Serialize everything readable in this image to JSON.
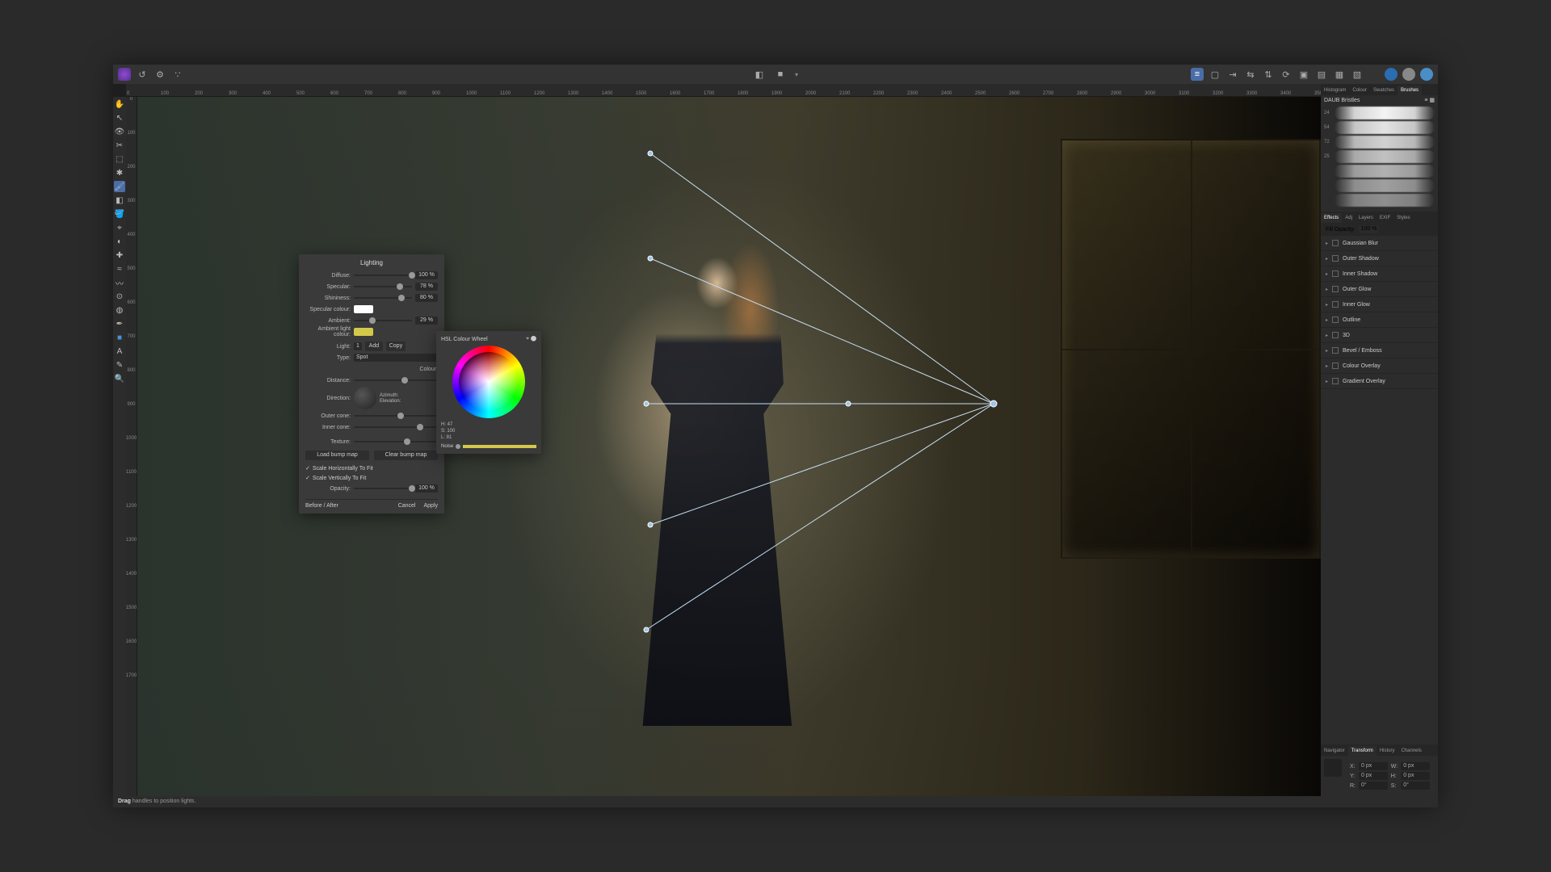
{
  "ruler": {
    "start": 0,
    "step": 100,
    "count": 40,
    "vcount": 18
  },
  "topbar": {
    "center_icons": [
      "◧",
      "■"
    ],
    "right_round": [
      "●",
      "●",
      "●"
    ]
  },
  "tabs_top_right": {
    "items": [
      "Histogram",
      "Colour",
      "Swatches",
      "Brushes"
    ],
    "active": 3
  },
  "brushes": {
    "category": "DAUB Bristles",
    "sizes": [
      "24",
      "54",
      "72",
      "25"
    ]
  },
  "tabs_fx": {
    "items": [
      "Effects",
      "Adj",
      "Layers",
      "EXIF",
      "Styles"
    ],
    "active": 0
  },
  "fx": {
    "fill_opacity_label": "Fill Opacity:",
    "fill_opacity_val": "100 %",
    "items": [
      "Gaussian Blur",
      "Outer Shadow",
      "Inner Shadow",
      "Outer Glow",
      "Inner Glow",
      "Outline",
      "3D",
      "Bevel / Emboss",
      "Colour Overlay",
      "Gradient Overlay"
    ]
  },
  "tabs_bottom": {
    "items": [
      "Navigator",
      "Transform",
      "History",
      "Channels"
    ],
    "active": 1
  },
  "transform": {
    "X": "0 px",
    "Y": "0 px",
    "W": "0 px",
    "H": "0 px",
    "R": "0°",
    "S": "0°"
  },
  "lighting": {
    "title": "Lighting",
    "diffuse_label": "Diffuse:",
    "diffuse_val": "100 %",
    "diffuse_pct": 98,
    "specular_label": "Specular:",
    "specular_val": "78 %",
    "specular_pct": 78,
    "shininess_label": "Shininess:",
    "shininess_val": "80 %",
    "shininess_pct": 80,
    "spec_colour_label": "Specular colour:",
    "spec_colour": "#ffffff",
    "ambient_label": "Ambient:",
    "ambient_val": "29 %",
    "ambient_pct": 29,
    "amb_colour_label": "Ambient light colour:",
    "amb_colour": "#d4c84a",
    "light_label": "Light:",
    "light_num": "1",
    "add": "Add",
    "copy": "Copy",
    "type_label": "Type:",
    "type_val": "Spot",
    "colour_label": "Colour:",
    "distance_label": "Distance:",
    "distance_pct": 60,
    "direction_label": "Direction:",
    "azimuth_label": "Azimuth:",
    "elevation_label": "Elevation:",
    "outer_label": "Outer cone:",
    "outer_pct": 55,
    "inner_label": "Inner cone:",
    "inner_pct": 78,
    "texture_label": "Texture:",
    "texture_pct": 62,
    "load_bump": "Load bump map",
    "clear_bump": "Clear bump map",
    "scale_h": "Scale Horizontally To Fit",
    "scale_v": "Scale Vertically To Fit",
    "opacity_label": "Opacity:",
    "opacity_val": "100 %",
    "opacity_pct": 98,
    "before_after": "Before / After",
    "cancel": "Cancel",
    "apply": "Apply"
  },
  "hsl": {
    "title": "HSL Colour Wheel",
    "H": "H: 47",
    "S": "S: 100",
    "L": "L: 81",
    "noise_label": "Noise"
  },
  "status": {
    "bold": "Drag",
    "rest": " handles to position lights."
  }
}
